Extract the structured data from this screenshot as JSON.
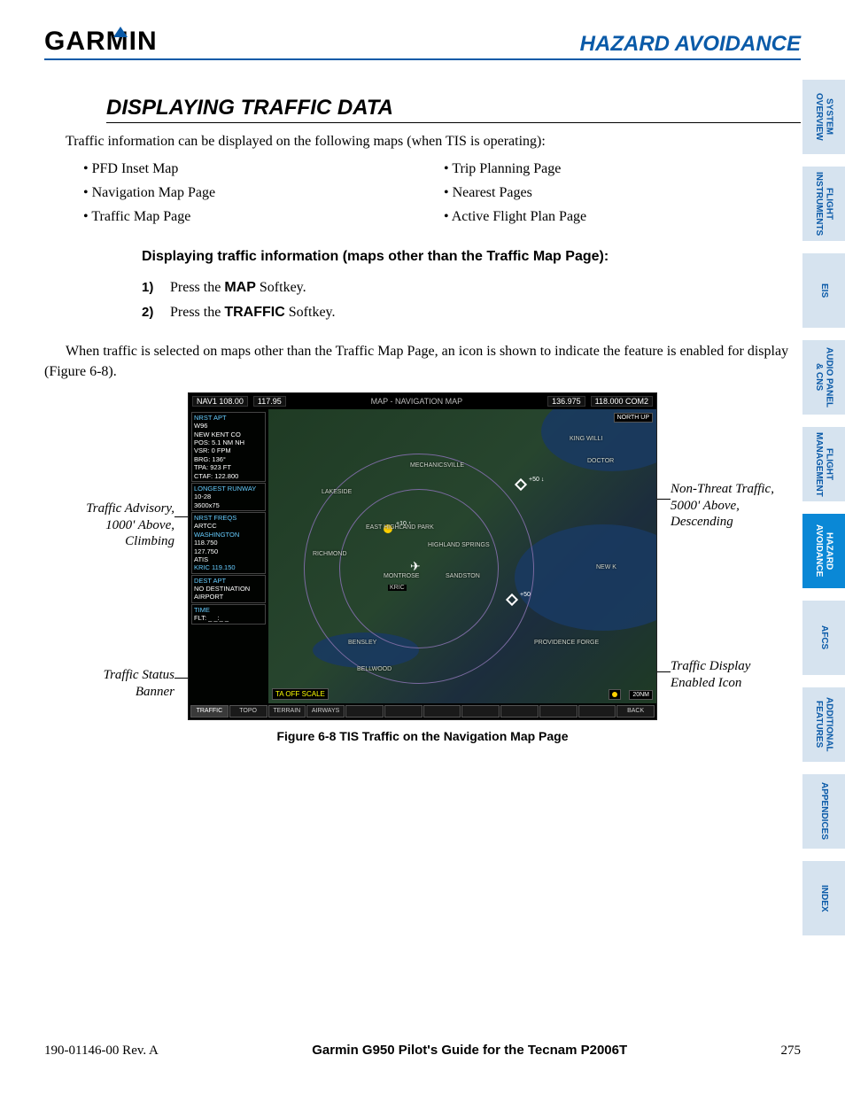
{
  "header": {
    "logo_text": "GARMIN",
    "title": "HAZARD AVOIDANCE"
  },
  "section": {
    "heading": "DISPLAYING TRAFFIC DATA",
    "intro": "Traffic information can be displayed on the following maps (when TIS is operating):",
    "bullets_left": [
      "PFD Inset Map",
      "Navigation Map Page",
      "Traffic Map Page"
    ],
    "bullets_right": [
      "Trip Planning Page",
      "Nearest Pages",
      "Active Flight Plan Page"
    ],
    "proc_heading": "Displaying traffic information (maps other than the Traffic Map Page):",
    "steps": [
      {
        "n": "1)",
        "pre": "Press the ",
        "key": "MAP",
        "post": " Softkey."
      },
      {
        "n": "2)",
        "pre": "Press the ",
        "key": "TRAFFIC",
        "post": " Softkey."
      }
    ],
    "para": "When traffic is selected on maps other than the Traffic Map Page, an icon is shown to indicate the feature is enabled for display (Figure 6-8)."
  },
  "figure": {
    "callouts": {
      "c1": "Traffic Advisory, 1000' Above, Climbing",
      "c2": "Traffic Status Banner",
      "c3": "Non-Threat Traffic, 5000' Above, Descending",
      "c4": "Traffic Display Enabled Icon"
    },
    "caption": "Figure 6-8  TIS Traffic on the Navigation Map Page",
    "top": {
      "nav1": "NAV1 108.00",
      "nav2": "117.95",
      "title": "MAP - NAVIGATION MAP",
      "com1": "136.975",
      "com2": "118.000 COM2"
    },
    "northup": "NORTH UP",
    "side": {
      "nrst_apt": "NRST APT",
      "apt": "W96",
      "apt_name": "NEW KENT CO",
      "pos": "POS: 5.1 NM NH",
      "vsr": "VSR: 0 FPM",
      "brg": "BRG: 136°",
      "tpa": "TPA: 923 FT",
      "ctaf": "CTAF: 122.800",
      "runway": "LONGEST RUNWAY",
      "rwy": "10-28",
      "rwy_len": "3600x75",
      "freq_lbl": "NRST FREQS",
      "artcc": "ARTCC",
      "artcc_name": "WASHINGTON",
      "f1": "118.750",
      "f2": "127.750",
      "atis": "ATIS",
      "atis_val": "KRIC 119.150",
      "dest_lbl": "DEST APT",
      "dest_val": "NO DESTINATION AIRPORT",
      "time_lbl": "TIME",
      "flt_lbl": "FLT: _ _:_ _"
    },
    "towns": [
      "MECHANICSVILLE",
      "LAKESIDE",
      "HIGHLAND SPRINGS",
      "EAST HIGHLAND PARK",
      "MONTROSE",
      "SANDSTON",
      "RICHMOND",
      "BENSLEY",
      "BELLWOOD",
      "PROVIDENCE FORGE",
      "NEW K",
      "KING WILLI",
      "DOCTOR"
    ],
    "kric": "KRIC",
    "ta_banner": "TA OFF SCALE",
    "scale": "20NM",
    "softkeys": [
      "TRAFFIC",
      "TOPO",
      "TERRAIN",
      "AIRWAYS",
      "",
      "",
      "",
      "",
      "",
      "",
      "",
      "BACK"
    ]
  },
  "side_tabs": [
    "SYSTEM OVERVIEW",
    "FLIGHT INSTRUMENTS",
    "EIS",
    "AUDIO PANEL & CNS",
    "FLIGHT MANAGEMENT",
    "HAZARD AVOIDANCE",
    "AFCS",
    "ADDITIONAL FEATURES",
    "APPENDICES",
    "INDEX"
  ],
  "footer": {
    "doc": "190-01146-00  Rev. A",
    "guide": "Garmin G950 Pilot's Guide for the Tecnam P2006T",
    "page": "275"
  }
}
